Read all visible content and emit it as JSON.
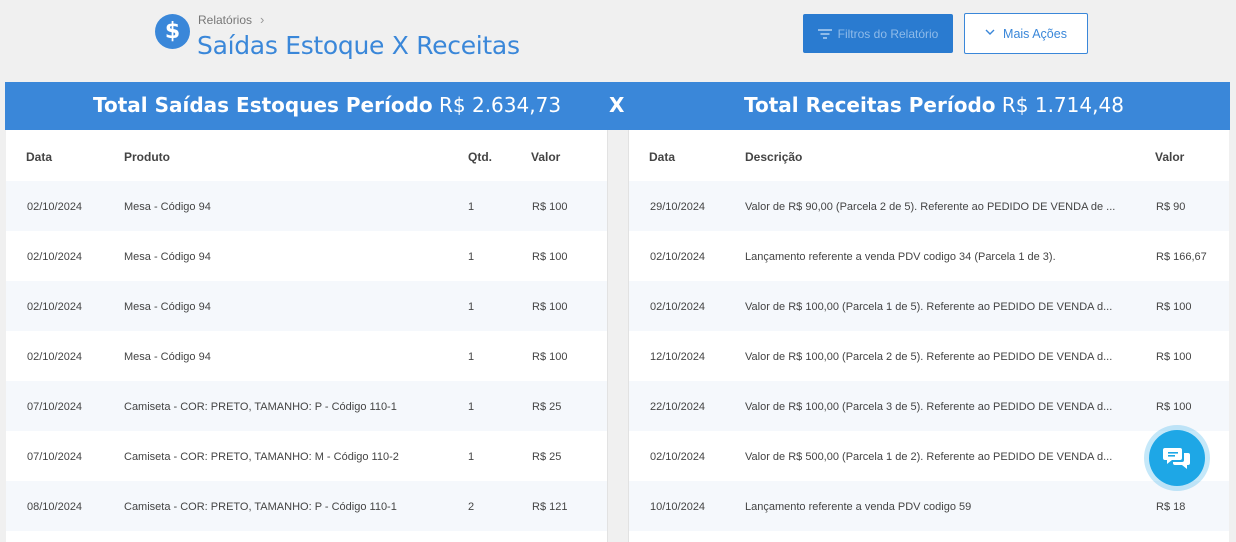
{
  "header": {
    "icon_symbol": "$",
    "breadcrumb": "Relatórios",
    "title": "Saídas Estoque X Receitas",
    "filter_button": "Filtros do Relatório",
    "more_button": "Mais Ações"
  },
  "banner": {
    "left_label": "Total Saídas Estoques Período",
    "left_amount": "R$ 2.634,73",
    "separator": "X",
    "right_label": "Total Receitas Período",
    "right_amount": "R$ 1.714,48"
  },
  "stock_table": {
    "headers": [
      "Data",
      "Produto",
      "Qtd.",
      "Valor"
    ],
    "rows": [
      {
        "date": "02/10/2024",
        "product": "Mesa - Código 94",
        "qty": "1",
        "value": "R$ 100"
      },
      {
        "date": "02/10/2024",
        "product": "Mesa - Código 94",
        "qty": "1",
        "value": "R$ 100"
      },
      {
        "date": "02/10/2024",
        "product": "Mesa - Código 94",
        "qty": "1",
        "value": "R$ 100"
      },
      {
        "date": "02/10/2024",
        "product": "Mesa - Código 94",
        "qty": "1",
        "value": "R$ 100"
      },
      {
        "date": "07/10/2024",
        "product": "Camiseta - COR: PRETO, TAMANHO: P - Código 110-1",
        "qty": "1",
        "value": "R$ 25"
      },
      {
        "date": "07/10/2024",
        "product": "Camiseta - COR: PRETO, TAMANHO: M - Código 110-2",
        "qty": "1",
        "value": "R$ 25"
      },
      {
        "date": "08/10/2024",
        "product": "Camiseta - COR: PRETO, TAMANHO: P - Código 110-1",
        "qty": "2",
        "value": "R$ 121"
      }
    ]
  },
  "revenue_table": {
    "headers": [
      "Data",
      "Descrição",
      "Valor"
    ],
    "rows": [
      {
        "date": "29/10/2024",
        "description": "Valor de R$ 90,00 (Parcela 2 de 5). Referente ao PEDIDO DE VENDA de ...",
        "value": "R$ 90"
      },
      {
        "date": "02/10/2024",
        "description": "Lançamento referente a venda PDV codigo 34 (Parcela 1 de 3).",
        "value": "R$ 166,67"
      },
      {
        "date": "02/10/2024",
        "description": "Valor de R$ 100,00 (Parcela 1 de 5). Referente ao PEDIDO DE VENDA d...",
        "value": "R$ 100"
      },
      {
        "date": "12/10/2024",
        "description": "Valor de R$ 100,00 (Parcela 2 de 5). Referente ao PEDIDO DE VENDA d...",
        "value": "R$ 100"
      },
      {
        "date": "22/10/2024",
        "description": "Valor de R$ 100,00 (Parcela 3 de 5). Referente ao PEDIDO DE VENDA d...",
        "value": "R$ 100"
      },
      {
        "date": "02/10/2024",
        "description": "Valor de R$ 500,00 (Parcela 1 de 2). Referente ao PEDIDO DE VENDA d...",
        "value": ""
      },
      {
        "date": "10/10/2024",
        "description": "Lançamento referente a venda PDV codigo 59",
        "value": "R$ 18"
      }
    ]
  },
  "colors": {
    "accent": "#3a87d9",
    "filter_button": "#2a7bd0",
    "chat": "#1ea7e6"
  },
  "icons": {
    "logo": "dollar-icon",
    "breadcrumb_separator": "chevron-right-icon",
    "filter": "filter-icon",
    "more": "chevron-down-icon",
    "chat": "chat-icon"
  }
}
